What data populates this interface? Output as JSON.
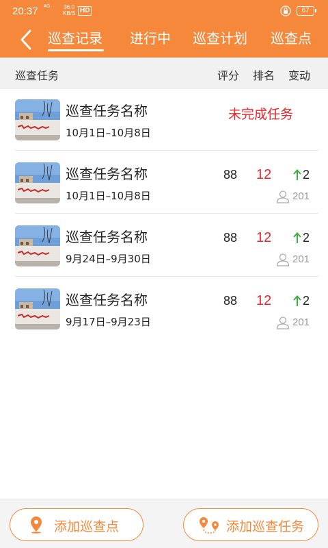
{
  "status": {
    "time": "20:37",
    "net": "4G",
    "speed_value": "36.0",
    "speed_unit": "KB/S",
    "hd": "HD",
    "battery": "67"
  },
  "nav": {
    "tabs": [
      "巡查记录",
      "进行中",
      "巡查计划",
      "巡查点"
    ],
    "active_tab": "巡查记录"
  },
  "columns": {
    "task": "巡查任务",
    "score": "评分",
    "rank": "排名",
    "change": "变动"
  },
  "rows": [
    {
      "name": "巡查任务名称",
      "date": "10月1日–10月8日",
      "status": "未完成任务"
    },
    {
      "name": "巡查任务名称",
      "date": "10月1日–10月8日",
      "score": "88",
      "rank": "12",
      "change": "2",
      "people": "201"
    },
    {
      "name": "巡查任务名称",
      "date": "9月24日–9月30日",
      "score": "88",
      "rank": "12",
      "change": "2",
      "people": "201"
    },
    {
      "name": "巡查任务名称",
      "date": "9月17日–9月23日",
      "score": "88",
      "rank": "12",
      "change": "2",
      "people": "201"
    }
  ],
  "actions": {
    "add_point": "添加巡查点",
    "add_task": "添加巡查任务"
  },
  "colors": {
    "accent": "#f5883a",
    "alert": "#e8262b",
    "up": "#3cae3c"
  },
  "icons": {
    "back": "chevron-left-icon",
    "lock": "lock-icon",
    "person": "person-icon",
    "arrow_up": "arrow-up-icon",
    "location": "location-pin-icon",
    "route": "route-icon"
  }
}
